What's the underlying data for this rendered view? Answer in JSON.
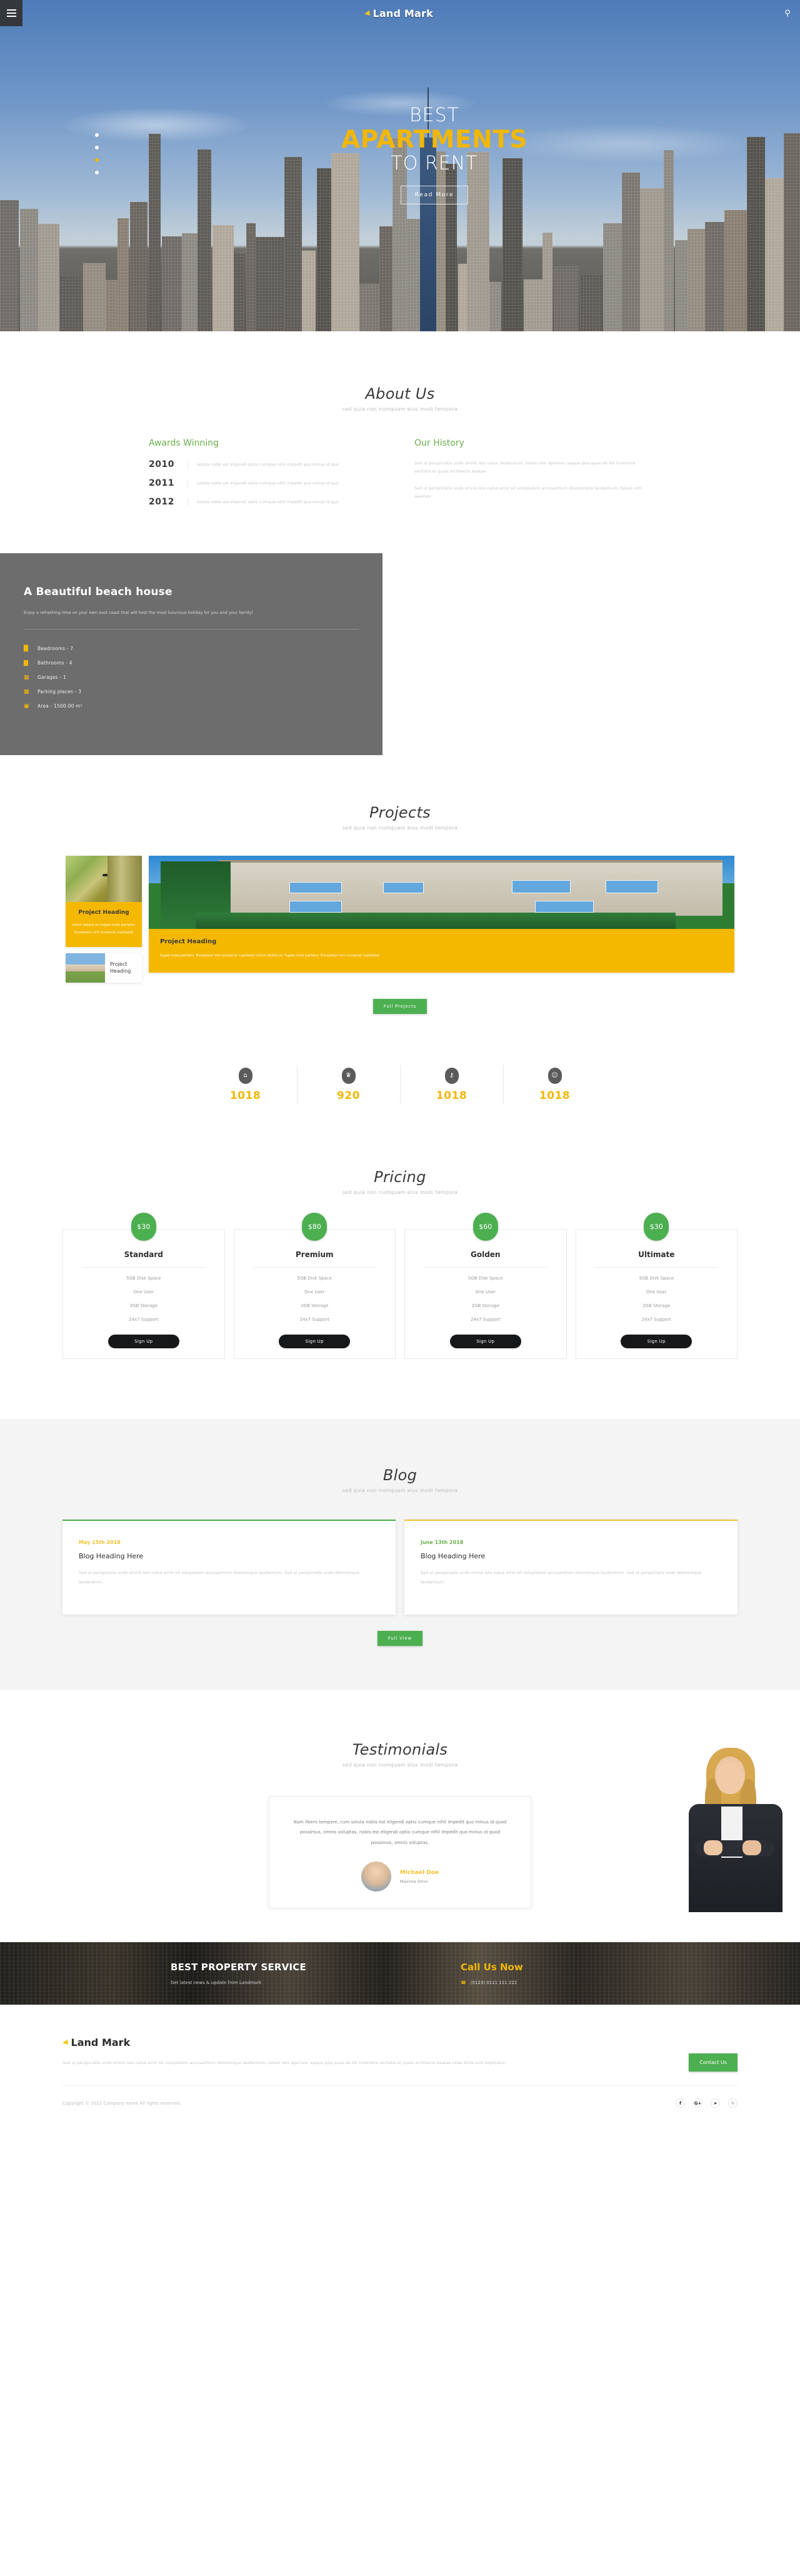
{
  "brand": {
    "mark": "paper-plane-icon",
    "name": "Land Mark"
  },
  "nav": {
    "menu_label": "menu-icon",
    "search_label": "search-icon"
  },
  "hero": {
    "line1": "BEST",
    "line2": "APARTMENTS",
    "line3": "TO RENT",
    "cta": "Read More",
    "slides": 4,
    "active_slide": 3
  },
  "about": {
    "title": "About Us",
    "subtitle": "sed quia non numquam eius modi tempora",
    "awards_title": "Awards Winning",
    "awards": [
      {
        "year": "2010",
        "text": "soluta nobis est eligendi optio cumque nihil impedit quo minus id quo"
      },
      {
        "year": "2011",
        "text": "soluta nobis est eligendi optio cumque nihil impedit quo minus id quo"
      },
      {
        "year": "2012",
        "text": "soluta nobis est eligendi optio cumque nihil impedit quo minus id quo"
      }
    ],
    "history_title": "Our History",
    "history": [
      "Sed ut perspiciatis unde omnis iste natus laudantium, totam rem aperiam, eaque ipsa quae ab illo inventore veritatis et quasi architecto beatae",
      "Sed ut perspiciatis unde omnis iste natus error sit voluptatem accusantium doloremque laudantium, totam rem aperiam"
    ]
  },
  "beach": {
    "title": "A Beautiful beach house",
    "lead": "Enjoy a refreshing time on your own east coast that will host the most luxurious holiday for you and your family!",
    "features": [
      {
        "icon": "bed-icon",
        "label": "Beadrooms - 7"
      },
      {
        "icon": "bath-icon",
        "label": "Bathrooms - 4"
      },
      {
        "icon": "garage-icon",
        "label": "Garages - 1"
      },
      {
        "icon": "car-icon",
        "label": "Parking places - 3"
      },
      {
        "icon": "area-icon",
        "label": "Area - 1500.00 m²"
      }
    ]
  },
  "projects": {
    "title": "Projects",
    "subtitle": "sed quia non numquam eius modi tempora",
    "small_card": {
      "heading": "Project Heading",
      "text": "cillum dolore eu fugiat nulla pariatur. Excepteur sint occaecat cupidatat"
    },
    "row_card": {
      "heading": "Project Heading"
    },
    "big_card": {
      "heading": "Project Heading",
      "text": "fugiat nulla pariatur. Excepteur sint occaecat cupidatat cillum dolore eu fugiat nulla pariatur. Excepteur sint occaecat cupidatat"
    },
    "button": "Full Projects"
  },
  "stats": [
    {
      "icon": "home-icon",
      "glyph": "⌂",
      "value": "1018"
    },
    {
      "icon": "trophy-icon",
      "glyph": "Ἴ6",
      "value": "920"
    },
    {
      "icon": "key-icon",
      "glyph": "⚷",
      "value": "1018"
    },
    {
      "icon": "smiley-icon",
      "glyph": "☺",
      "value": "1018"
    }
  ],
  "pricing": {
    "title": "Pricing",
    "subtitle": "sed quia non numquam eius modi tempora",
    "plans": [
      {
        "price": "$30",
        "name": "Standard",
        "features": [
          "5GB Disk Space",
          "One User",
          "2GB Storage",
          "24x7 Support"
        ],
        "button": "Sign Up"
      },
      {
        "price": "$80",
        "name": "Premium",
        "features": [
          "5GB Disk Space",
          "One User",
          "2GB Storage",
          "24x7 Support"
        ],
        "button": "Sign Up"
      },
      {
        "price": "$60",
        "name": "Golden",
        "features": [
          "5GB Disk Space",
          "One User",
          "2GB Storage",
          "24x7 Support"
        ],
        "button": "Sign Up"
      },
      {
        "price": "$30",
        "name": "Ultimate",
        "features": [
          "5GB Disk Space",
          "One User",
          "2GB Storage",
          "24x7 Support"
        ],
        "button": "Sign Up"
      }
    ]
  },
  "blog": {
    "title": "Blog",
    "subtitle": "sed quia non numquam eius modi tempora",
    "posts": [
      {
        "date": "May 15th 2018",
        "heading": "Blog Heading Here",
        "text": "Sed ut perspiciatis unde omnis iste natus error sit voluptatem accusantium doloremque laudantium. Sed ut perspiciatis unde doloremque laudantium."
      },
      {
        "date": "June 13th 2018",
        "heading": "Blog Heading Here",
        "text": "Sed ut perspiciatis unde omnis iste natus error sit voluptatem accusantium doloremque laudantium. Sed ut perspiciatis unde doloremque laudantium."
      }
    ],
    "button": "Full View"
  },
  "testimonials": {
    "title": "Testimonials",
    "subtitle": "sed quia non numquam eius modi tempora",
    "quote": "Nam libero tempore, cum soluta nobis est eligendi optio cumque nihil impedit quo minus id quod possimus, omnis voluptas, nobis est eligendi optio cumque nihil impedit quo minus id quod possimus, omnis voluptas.",
    "author": "Michael Doe",
    "role": "Maxime Omni"
  },
  "cta": {
    "heading": "BEST PROPERTY SERVICE",
    "sub": "Get latest news & update from Landmark",
    "call_heading": "Call Us Now",
    "phone": "(0123) 0111 111 222",
    "phone_icon": "phone-icon"
  },
  "footer": {
    "logo": "Land Mark",
    "text": "Sed ut perspiciatis unde omnis iste natus error sit voluptatem accusantium doloremque laudantium, totam rem aperiam, eaque ipsa quae ab illo inventore veritatis et quasi architecto beatae vitae dicta sunt explicabo.",
    "contact_button": "Contact Us",
    "copyright": "Copyright © 2021 Company name All rights reserved.",
    "socials": [
      {
        "name": "facebook-icon",
        "glyph": "f"
      },
      {
        "name": "google-plus-icon",
        "glyph": "G+"
      },
      {
        "name": "twitter-icon",
        "glyph": "✉"
      },
      {
        "name": "dribbble-icon",
        "glyph": "⊕"
      }
    ]
  },
  "colors": {
    "accent_yellow": "#f2b705",
    "accent_green": "#4caf50",
    "dark": "#34373b",
    "card_yellow": "#f5b800"
  }
}
